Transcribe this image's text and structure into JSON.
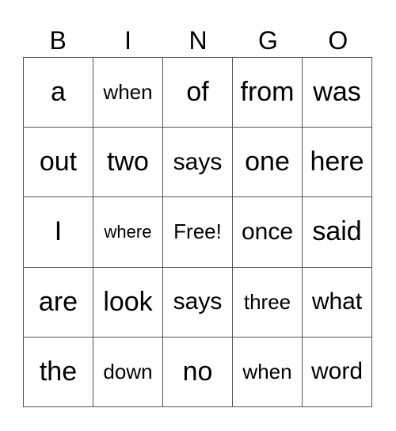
{
  "header": [
    "B",
    "I",
    "N",
    "G",
    "O"
  ],
  "cells": [
    [
      "a",
      "when",
      "of",
      "from",
      "was"
    ],
    [
      "out",
      "two",
      "says",
      "one",
      "here"
    ],
    [
      "I",
      "where",
      "Free!",
      "once",
      "said"
    ],
    [
      "are",
      "look",
      "says",
      "three",
      "what"
    ],
    [
      "the",
      "down",
      "no",
      "when",
      "word"
    ]
  ]
}
